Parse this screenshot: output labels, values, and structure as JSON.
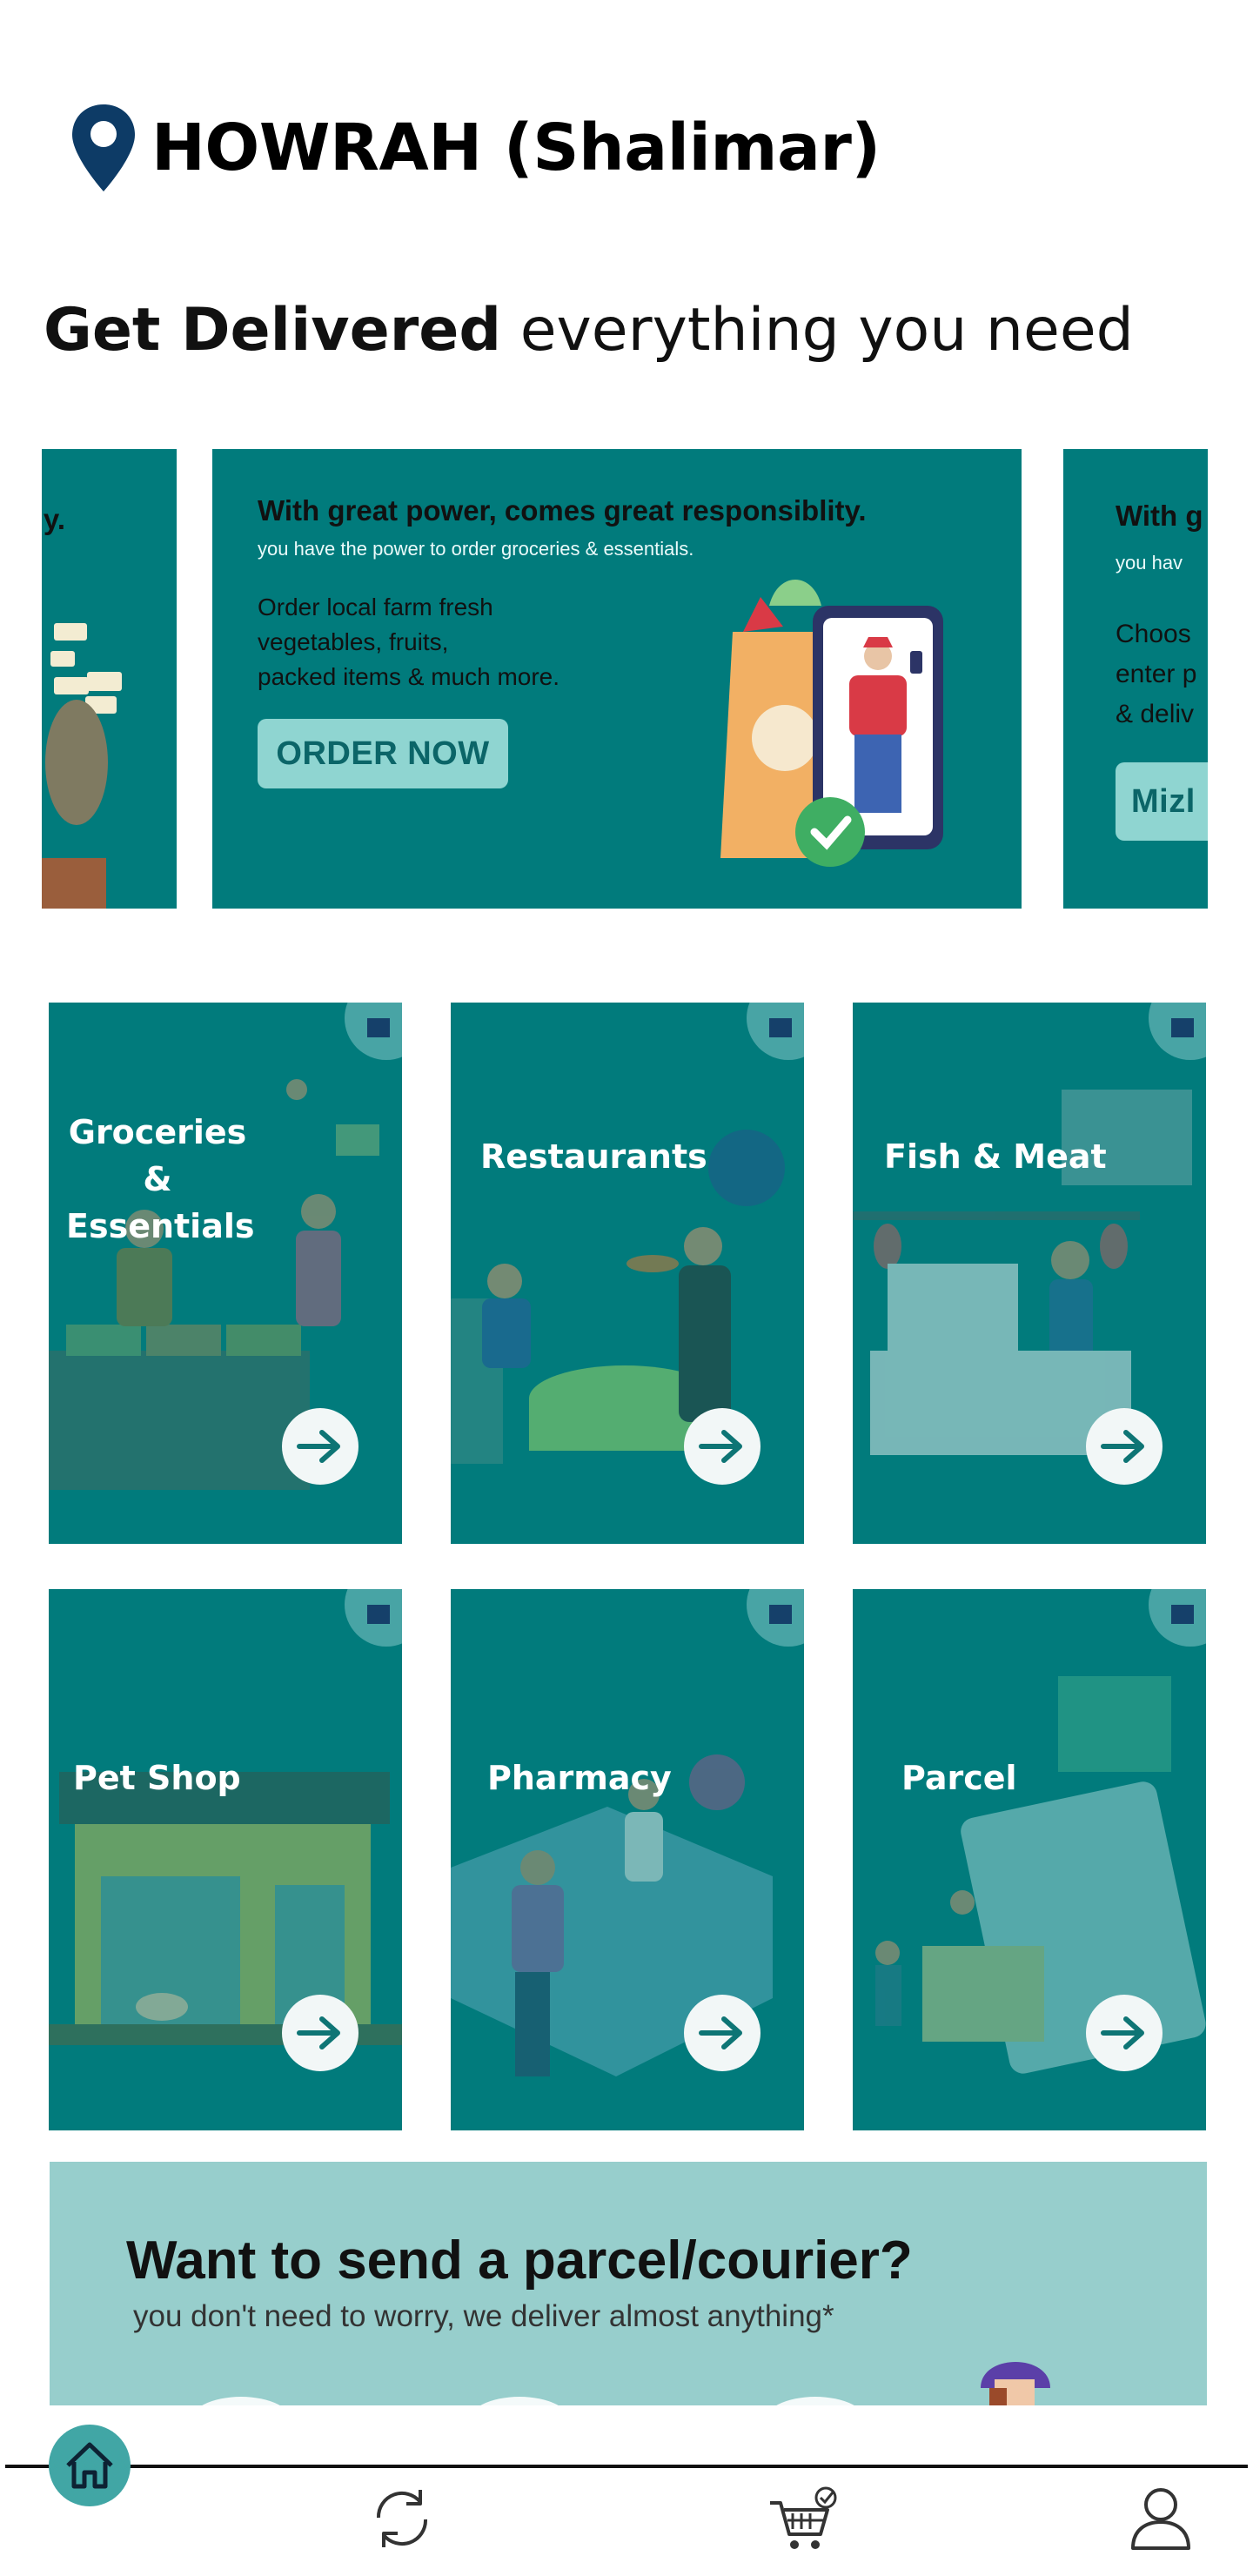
{
  "location": {
    "name": "HOWRAH (Shalimar)",
    "icon": "map-pin-icon"
  },
  "headline": {
    "bold": "Get Delivered",
    "regular": "everything you need"
  },
  "colors": {
    "teal": "#017b7c",
    "light_teal": "#97cecc",
    "button": "#8fd5d1",
    "pin": "#0d3b66"
  },
  "carousel": {
    "prev": {
      "fragment": "y."
    },
    "main": {
      "title": "With great power, comes great responsiblity.",
      "subtitle": "you have the power to order groceries & essentials.",
      "body_lines": [
        "Order local farm fresh",
        "vegetables, fruits,",
        "packed items & much more."
      ],
      "button": "ORDER NOW"
    },
    "next": {
      "title": "With g",
      "subtitle": "you hav",
      "body_lines": [
        "Choos",
        "enter p",
        "& deliv"
      ],
      "button": "Mizl"
    }
  },
  "categories": [
    {
      "label_lines": [
        "Groceries &",
        "Essentials"
      ],
      "icon": "arrow-right-icon"
    },
    {
      "label_lines": [
        "Restaurants"
      ],
      "icon": "arrow-right-icon"
    },
    {
      "label_lines": [
        "Fish & Meat"
      ],
      "icon": "arrow-right-icon"
    },
    {
      "label_lines": [
        "Pet Shop"
      ],
      "icon": "arrow-right-icon"
    },
    {
      "label_lines": [
        "Pharmacy"
      ],
      "icon": "arrow-right-icon"
    },
    {
      "label_lines": [
        "Parcel"
      ],
      "icon": "arrow-right-icon"
    }
  ],
  "parcel_banner": {
    "title": "Want to send a parcel/courier?",
    "subtitle": "you don't need to worry, we deliver almost anything*"
  },
  "bottom_nav": [
    {
      "name": "home",
      "icon": "home-icon"
    },
    {
      "name": "reorder",
      "icon": "refresh-icon"
    },
    {
      "name": "cart",
      "icon": "cart-check-icon"
    },
    {
      "name": "profile",
      "icon": "user-icon"
    }
  ]
}
